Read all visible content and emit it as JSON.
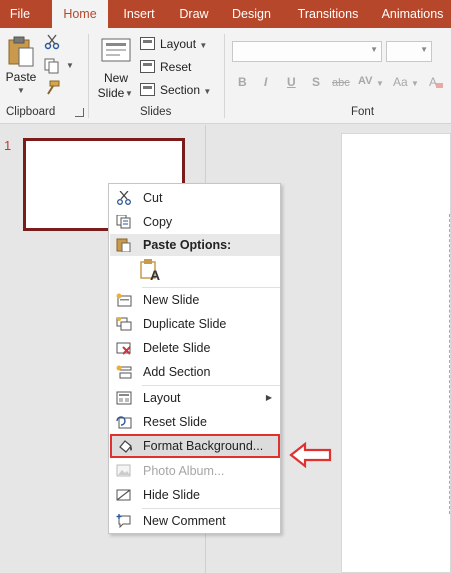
{
  "tabs": [
    {
      "label": "File",
      "active": false
    },
    {
      "label": "Home",
      "active": true
    },
    {
      "label": "Insert",
      "active": false
    },
    {
      "label": "Draw",
      "active": false
    },
    {
      "label": "Design",
      "active": false
    },
    {
      "label": "Transitions",
      "active": false
    },
    {
      "label": "Animations",
      "active": false
    }
  ],
  "ribbon": {
    "clipboard": {
      "paste_label": "Paste",
      "group_label": "Clipboard"
    },
    "slides": {
      "new_slide_line1": "New",
      "new_slide_line2": "Slide",
      "layout_label": "Layout",
      "reset_label": "Reset",
      "section_label": "Section",
      "group_label": "Slides"
    },
    "font": {
      "group_label": "Font",
      "font_name_value": "",
      "font_size_value": "",
      "buttons": [
        "B",
        "I",
        "U",
        "S",
        "abc",
        "AV",
        "Aa"
      ]
    }
  },
  "slide_pane": {
    "slide_number": "1"
  },
  "context_menu": {
    "items": [
      {
        "label": "Cut",
        "icon": "scissors-icon",
        "enabled": true
      },
      {
        "label": "Copy",
        "icon": "copy-icon",
        "enabled": true
      },
      {
        "label": "Paste Options:",
        "icon": "paste-icon",
        "enabled": true,
        "header": true
      },
      {
        "label": "",
        "icon": "paste-keep-text-icon",
        "enabled": true
      },
      {
        "label": "New Slide",
        "icon": "new-slide-icon",
        "enabled": true
      },
      {
        "label": "Duplicate Slide",
        "icon": "duplicate-slide-icon",
        "enabled": true
      },
      {
        "label": "Delete Slide",
        "icon": "delete-slide-icon",
        "enabled": true
      },
      {
        "label": "Add Section",
        "icon": "add-section-icon",
        "enabled": true
      },
      {
        "label": "Layout",
        "icon": "layout-icon",
        "enabled": true,
        "submenu": true
      },
      {
        "label": "Reset Slide",
        "icon": "reset-slide-icon",
        "enabled": true
      },
      {
        "label": "Format Background...",
        "icon": "format-background-icon",
        "enabled": true,
        "highlighted": true
      },
      {
        "label": "Photo Album...",
        "icon": "photo-album-icon",
        "enabled": false
      },
      {
        "label": "Hide Slide",
        "icon": "hide-slide-icon",
        "enabled": true
      },
      {
        "label": "New Comment",
        "icon": "new-comment-icon",
        "enabled": true
      }
    ]
  },
  "colors": {
    "accent": "#b7472a",
    "highlight_border": "#e03030",
    "thumb_border": "#7a1c1c"
  }
}
